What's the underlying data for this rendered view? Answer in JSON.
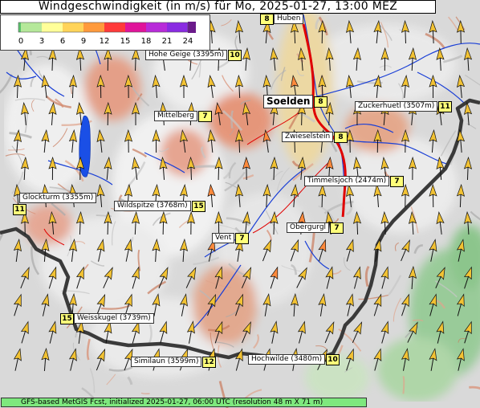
{
  "title": "Windgeschwindigkeit (in m/s) für Mo, 2025-01-27, 13:00 MEZ",
  "legend": {
    "ticks": [
      "0",
      "3",
      "6",
      "9",
      "12",
      "15",
      "18",
      "21",
      "24"
    ],
    "colors": [
      "#59c36b",
      "#b5e89a",
      "#ffff99",
      "#ffd45a",
      "#ff9a3c",
      "#ff3a3a",
      "#e0149a",
      "#b82bd9",
      "#8a2be2",
      "#6a1a8a"
    ]
  },
  "places": [
    {
      "name": "Huben",
      "value": "8"
    },
    {
      "name": "Hohe Geige (3395m)",
      "value": "10"
    },
    {
      "name": "Soelden",
      "value": "8"
    },
    {
      "name": "Zuckerhuetl (3507m)",
      "value": "11"
    },
    {
      "name": "Mittelberg",
      "value": "7"
    },
    {
      "name": "Zwieselstein",
      "value": "8"
    },
    {
      "name": "Glockturm (3355m)",
      "value": "11"
    },
    {
      "name": "Wildspitze (3768m)",
      "value": "15"
    },
    {
      "name": "Timmelsjoch (2474m)",
      "value": "7"
    },
    {
      "name": "Obergurgl",
      "value": "7"
    },
    {
      "name": "Vent",
      "value": "7"
    },
    {
      "name": "Weisskugel (3739m)",
      "value": "15"
    },
    {
      "name": "Similaun (3599m)",
      "value": "12"
    },
    {
      "name": "Hochwilde (3480m)",
      "value": "10"
    }
  ],
  "footer": "GFS-based MetGIS Fcst, initialized 2025-01-27, 06:00 UTC  (resolution 48 m X 71 m)",
  "colors": {
    "arrow_default": "#f2c233",
    "arrow_strong": "#ff8a3c",
    "border": "#333333",
    "river": "#1a3fd6",
    "road": "#e00000",
    "lake": "#1a4fe6"
  }
}
